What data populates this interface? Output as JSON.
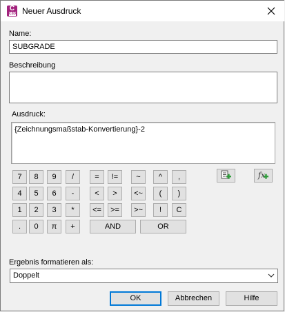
{
  "window": {
    "title": "Neuer Ausdruck",
    "icon_letter": "C",
    "icon_version": "C3D",
    "accent": "#a3237e"
  },
  "name": {
    "label": "Name:",
    "value": "SUBGRADE"
  },
  "description": {
    "label": "Beschreibung",
    "value": ""
  },
  "expression": {
    "label": "Ausdruck:",
    "value": "{Zeichnungsmaßstab-Konvertierung}-2"
  },
  "keypad": {
    "row1": [
      "7",
      "8",
      "9",
      "/",
      "=",
      "!=",
      "~",
      "^",
      ","
    ],
    "row2": [
      "4",
      "5",
      "6",
      "-",
      "<",
      ">",
      "<~",
      "(",
      ")"
    ],
    "row3": [
      "1",
      "2",
      "3",
      "*",
      "<=",
      ">=",
      ">~",
      "!",
      "C"
    ],
    "row4": [
      ".",
      "0",
      "π",
      "+"
    ],
    "and_label": "AND",
    "or_label": "OR",
    "insert_property_icon": "insert-property-icon",
    "insert_function_icon": "insert-function-icon"
  },
  "format": {
    "label": "Ergebnis formatieren als:",
    "value": "Doppelt"
  },
  "buttons": {
    "ok": "OK",
    "cancel": "Abbrechen",
    "help": "Hilfe"
  }
}
